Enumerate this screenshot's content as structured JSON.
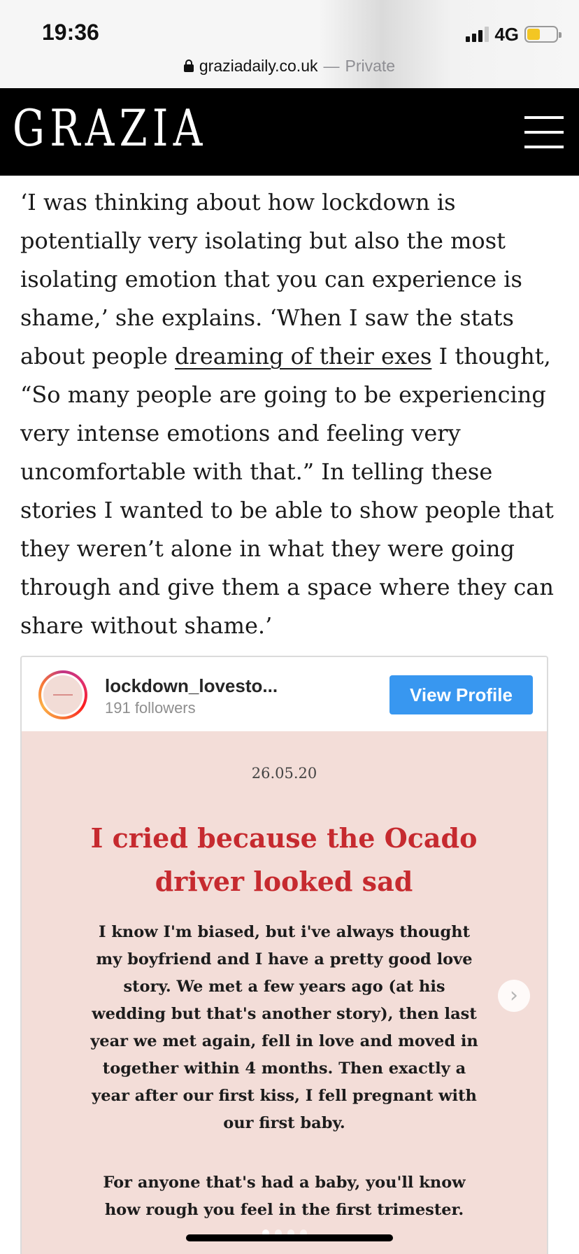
{
  "status_bar": {
    "time": "19:36",
    "network": "4G",
    "signal_bars_active": 3,
    "signal_bars_total": 4,
    "battery_level": 0.45,
    "battery_color": "#f3c623"
  },
  "browser": {
    "domain": "graziadaily.co.uk",
    "separator": "—",
    "mode": "Private",
    "icon": "lock-icon"
  },
  "site": {
    "logo": "GRAZIA",
    "menu_icon": "hamburger-menu-icon",
    "header_color": "#000000"
  },
  "article": {
    "before_link": "‘I was thinking about how lockdown is potentially very isolating but also the most isolating emotion that you can experience is shame,’ she explains. ‘When I saw the stats about people ",
    "link_text": "dreaming of their exes",
    "after_link": " I thought, “So many people are going to be experiencing very intense emotions and feeling very uncomfortable with that.” In telling these stories I wanted to be able to show people that they weren’t alone in what they were going through and give them a space where they can share without shame.’"
  },
  "instagram_embed": {
    "account_name": "lockdown_lovesto...",
    "followers": "191 followers",
    "view_profile_label": "View Profile",
    "button_color": "#3897f0",
    "post": {
      "date": "26.05.20",
      "title": "I cried because the Ocado driver looked sad",
      "body_1": "I know I'm biased, but i've always thought my boyfriend and I have a pretty good love story. We met a few years ago (at his wedding but that's another story), then last year we met again, fell in love and moved in together within 4 months. Then exactly a year after our first kiss, I fell pregnant with our first baby.",
      "body_2": "For anyone that's had a baby, you'll know how rough you feel in the first trimester.",
      "background_color": "#f3ddd8",
      "title_color": "#c62a2f",
      "next_icon": "chevron-right-icon",
      "slide_count": 4,
      "active_slide": 1
    }
  }
}
